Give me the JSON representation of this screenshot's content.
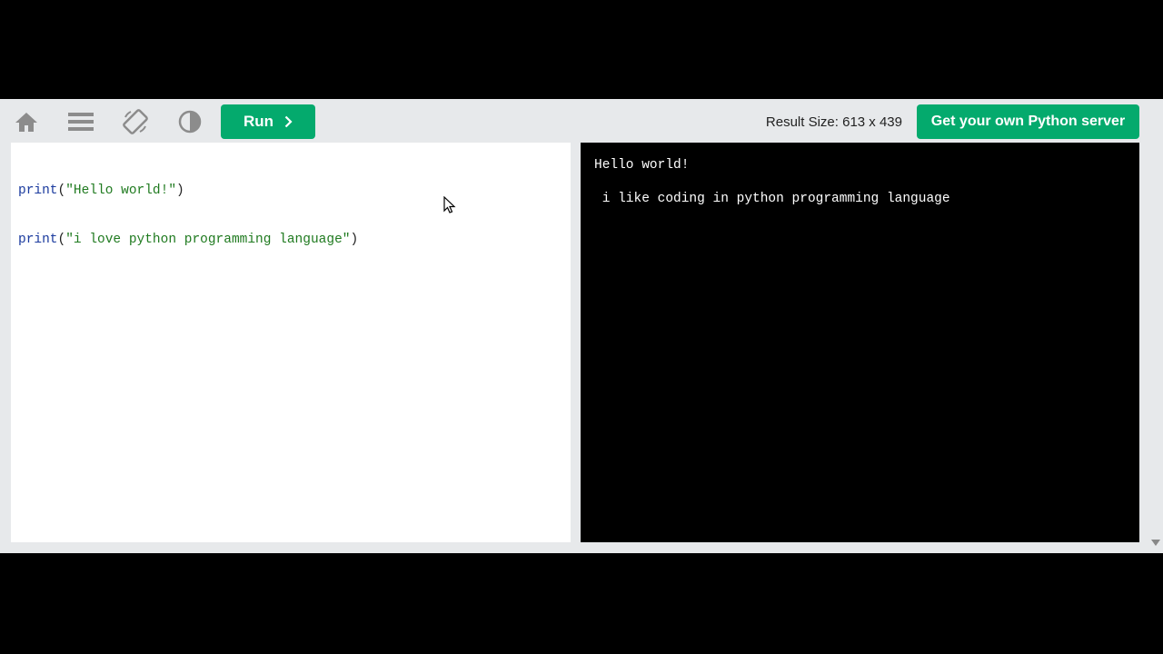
{
  "toolbar": {
    "icons": [
      "home-icon",
      "menu-icon",
      "rotate-icon",
      "contrast-icon"
    ],
    "run_label": "Run",
    "result_size": "Result Size: 613 x 439",
    "server_label": "Get your own Python server"
  },
  "editor": {
    "lines": [
      {
        "fn": "print",
        "open": "(",
        "str": "\"Hello world!\"",
        "close": ")"
      },
      {
        "fn": "print",
        "open": "(",
        "str": "\"i love python programming language\"",
        "close": ")"
      }
    ]
  },
  "output": {
    "lines": [
      "Hello world!",
      " i like coding in python programming language"
    ]
  },
  "colors": {
    "accent": "#04aa6d",
    "toolbar_bg": "#e7e9eb",
    "output_bg": "#000000",
    "code_fn": "#1a3a9e",
    "code_str": "#1f7a1f"
  }
}
